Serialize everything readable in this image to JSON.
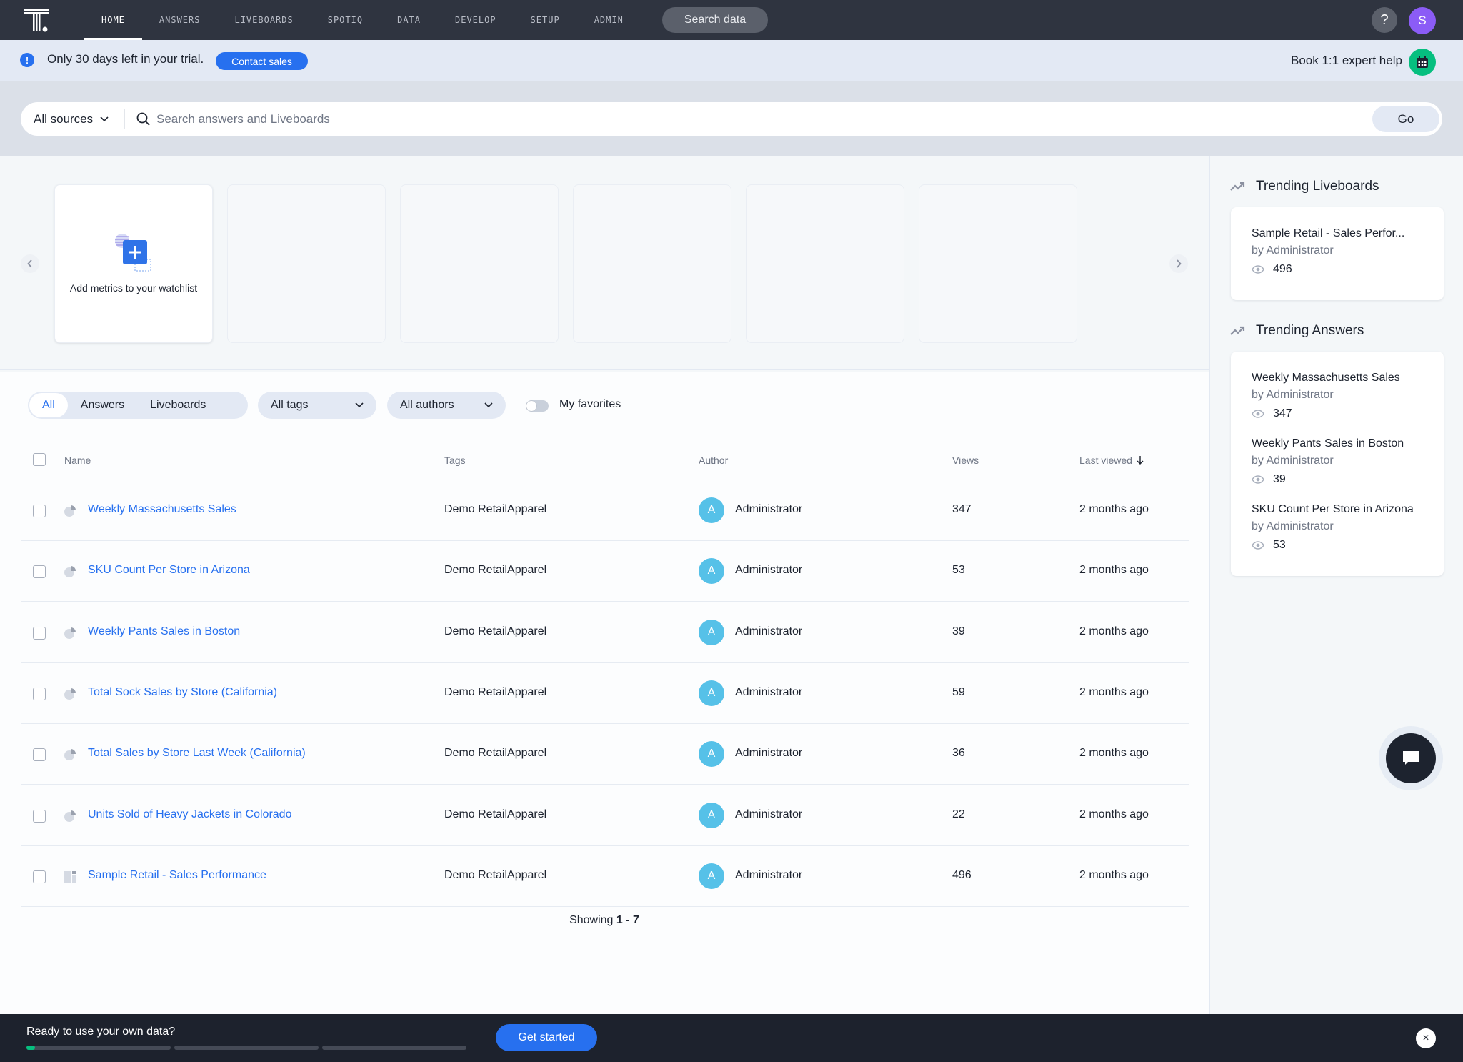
{
  "nav": {
    "items": [
      {
        "label": "HOME",
        "active": true
      },
      {
        "label": "ANSWERS",
        "active": false
      },
      {
        "label": "LIVEBOARDS",
        "active": false
      },
      {
        "label": "SPOTIQ",
        "active": false
      },
      {
        "label": "DATA",
        "active": false
      },
      {
        "label": "DEVELOP",
        "active": false
      },
      {
        "label": "SETUP",
        "active": false
      },
      {
        "label": "ADMIN",
        "active": false
      }
    ],
    "search_data_label": "Search data",
    "help_label": "?",
    "user_initial": "S",
    "logo_icon": "thoughtspot-logo"
  },
  "trial_banner": {
    "icon": "info-exclamation-icon",
    "text": "Only 30 days left in your trial.",
    "contact_label": "Contact sales",
    "book_label": "Book 1:1 expert help",
    "book_icon": "calendar-icon"
  },
  "search": {
    "sources_label": "All sources",
    "placeholder": "Search answers and Liveboards",
    "value": "",
    "go_label": "Go"
  },
  "watchlist": {
    "add_label": "Add metrics to your watchlist",
    "placeholder_cards": 5
  },
  "filters": {
    "segments": [
      {
        "label": "All",
        "active": true
      },
      {
        "label": "Answers",
        "active": false
      },
      {
        "label": "Liveboards",
        "active": false
      }
    ],
    "tags_label": "All tags",
    "authors_label": "All authors",
    "favorites_label": "My favorites",
    "favorites_on": false
  },
  "table": {
    "columns": [
      "Name",
      "Tags",
      "Author",
      "Views",
      "Last viewed"
    ],
    "sort_column": "Last viewed",
    "sort_direction": "descending",
    "rows": [
      {
        "name": "Weekly Massachusetts Sales",
        "type": "answer",
        "tag": "Demo RetailApparel",
        "author_initial": "A",
        "author": "Administrator",
        "views": "347",
        "last_viewed": "2 months ago"
      },
      {
        "name": "SKU Count Per Store in Arizona",
        "type": "answer",
        "tag": "Demo RetailApparel",
        "author_initial": "A",
        "author": "Administrator",
        "views": "53",
        "last_viewed": "2 months ago"
      },
      {
        "name": "Weekly Pants Sales in Boston",
        "type": "answer",
        "tag": "Demo RetailApparel",
        "author_initial": "A",
        "author": "Administrator",
        "views": "39",
        "last_viewed": "2 months ago"
      },
      {
        "name": "Total Sock Sales by Store (California)",
        "type": "answer",
        "tag": "Demo RetailApparel",
        "author_initial": "A",
        "author": "Administrator",
        "views": "59",
        "last_viewed": "2 months ago"
      },
      {
        "name": "Total Sales by Store Last Week (California)",
        "type": "answer",
        "tag": "Demo RetailApparel",
        "author_initial": "A",
        "author": "Administrator",
        "views": "36",
        "last_viewed": "2 months ago"
      },
      {
        "name": "Units Sold of Heavy Jackets in Colorado",
        "type": "answer",
        "tag": "Demo RetailApparel",
        "author_initial": "A",
        "author": "Administrator",
        "views": "22",
        "last_viewed": "2 months ago"
      },
      {
        "name": "Sample Retail - Sales Performance",
        "type": "liveboard",
        "tag": "Demo RetailApparel",
        "author_initial": "A",
        "author": "Administrator",
        "views": "496",
        "last_viewed": "2 months ago"
      }
    ],
    "showing_prefix": "Showing",
    "showing_range": "1 - 7"
  },
  "sidebar": {
    "trending_liveboards": {
      "title": "Trending Liveboards",
      "items": [
        {
          "title": "Sample Retail - Sales Perfor...",
          "by": "by Administrator",
          "views": "496"
        }
      ]
    },
    "trending_answers": {
      "title": "Trending Answers",
      "items": [
        {
          "title": "Weekly Massachusetts Sales",
          "by": "by Administrator",
          "views": "347"
        },
        {
          "title": "Weekly Pants Sales in Boston",
          "by": "by Administrator",
          "views": "39"
        },
        {
          "title": "SKU Count Per Store in Arizona",
          "by": "by Administrator",
          "views": "53"
        }
      ]
    }
  },
  "bottom_bar": {
    "text": "Ready to use your own data?",
    "get_started_label": "Get started",
    "progress_steps": [
      0.05,
      0,
      0
    ],
    "close_label": "×"
  },
  "colors": {
    "nav_bg": "#2f3440",
    "accent": "#2770ef",
    "success": "#06bf7f",
    "avatar_author": "#56c1e8",
    "avatar_user": "#8b5cf6"
  }
}
